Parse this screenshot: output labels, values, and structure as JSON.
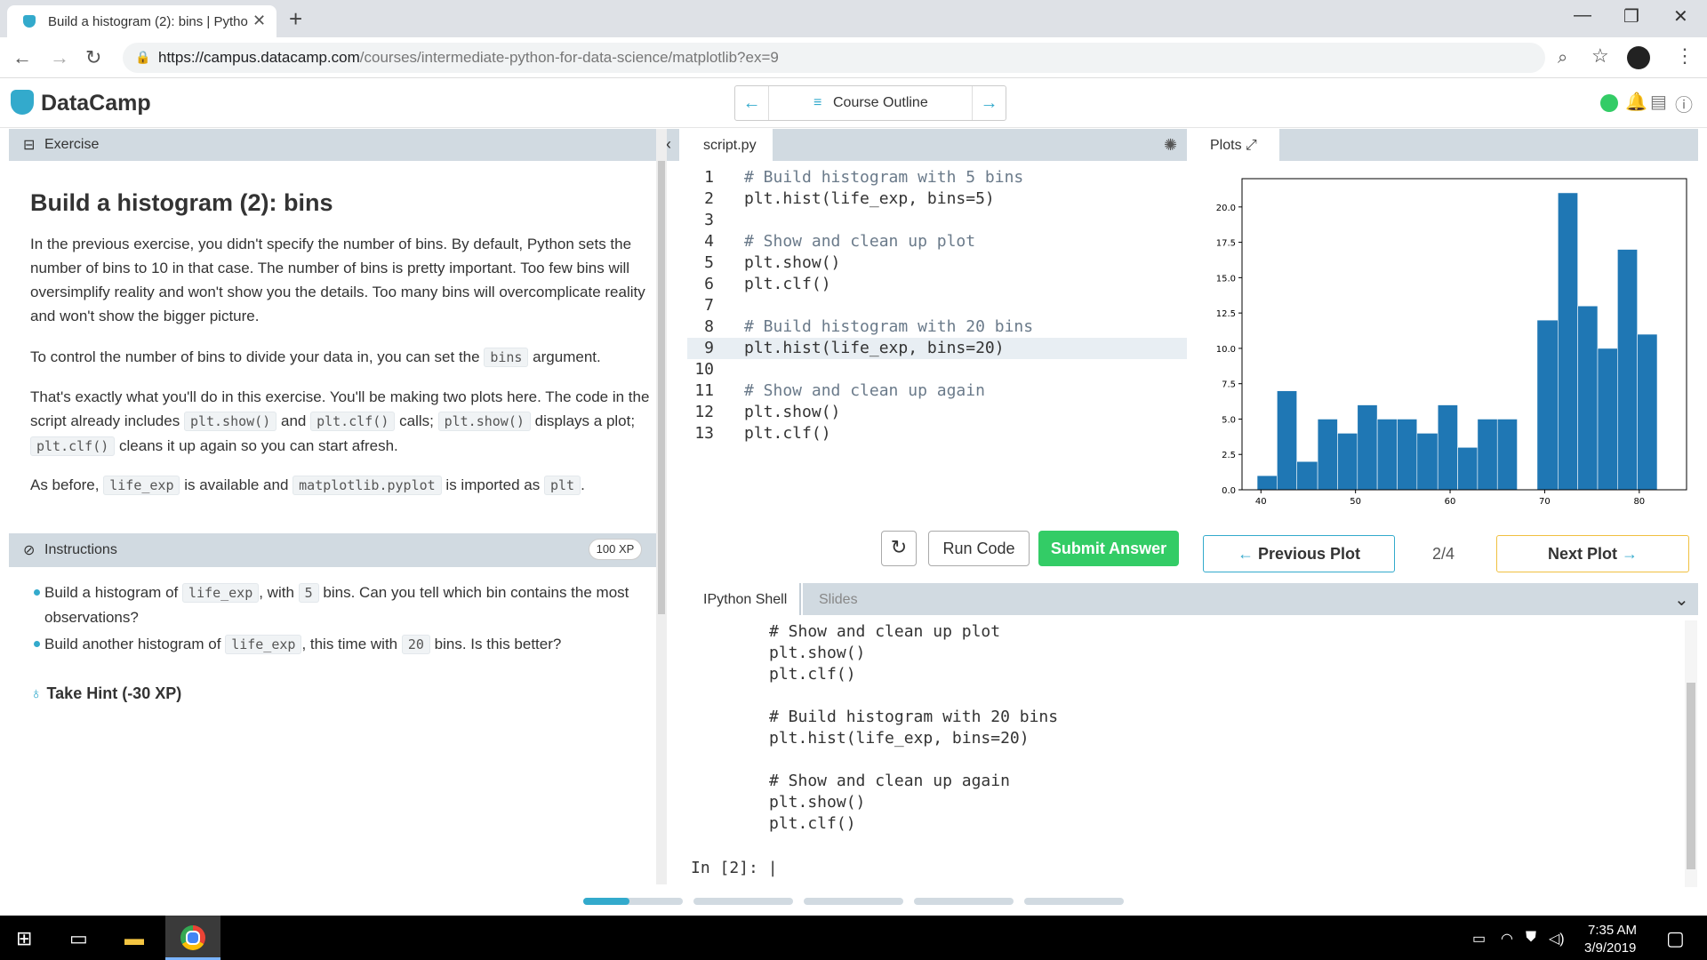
{
  "browser": {
    "tab_title": "Build a histogram (2): bins | Pytho",
    "url_host": "https://campus.datacamp.com",
    "url_path": "/courses/intermediate-python-for-data-science/matplotlib?ex=9"
  },
  "header": {
    "logo": "DataCamp",
    "course_outline": "Course Outline"
  },
  "exercise": {
    "panel_label": "Exercise",
    "title": "Build a histogram (2): bins",
    "p1": "In the previous exercise, you didn't specify the number of bins. By default, Python sets the number of bins to 10 in that case. The number of bins is pretty important. Too few bins will oversimplify reality and won't show you the details. Too many bins will overcomplicate reality and won't show the bigger picture.",
    "p2_a": "To control the number of bins to divide your data in, you can set the",
    "p2_code": "bins",
    "p2_b": "argument.",
    "p3_a": "That's exactly what you'll do in this exercise. You'll be making two plots here. The code in the script already includes",
    "p3_code1": "plt.show()",
    "p3_and": "and",
    "p3_code2": "plt.clf()",
    "p3_calls": "calls;",
    "p3_code3": "plt.show()",
    "p3_displays": "displays a plot;",
    "p3_code4": "plt.clf()",
    "p3_end": "cleans it up again so you can start afresh.",
    "p4_a": "As before,",
    "p4_code1": "life_exp",
    "p4_b": "is available and",
    "p4_code2": "matplotlib.pyplot",
    "p4_c": "is imported as",
    "p4_code3": "plt",
    "p4_d": "."
  },
  "instructions": {
    "label": "Instructions",
    "xp": "100 XP",
    "b1_a": "Build a histogram of",
    "b1_code1": "life_exp",
    "b1_b": ", with",
    "b1_code2": "5",
    "b1_c": "bins. Can you tell which bin contains the most observations?",
    "b2_a": "Build another histogram of",
    "b2_code1": "life_exp",
    "b2_b": ", this time with",
    "b2_code2": "20",
    "b2_c": "bins. Is this better?",
    "hint": "Take Hint (-30 XP)"
  },
  "editor": {
    "tab": "script.py",
    "lines": [
      "# Build histogram with 5 bins",
      "plt.hist(life_exp, bins=5)",
      "",
      "# Show and clean up plot",
      "plt.show()",
      "plt.clf()",
      "",
      "# Build histogram with 20 bins",
      "plt.hist(life_exp, bins=20)",
      "",
      "# Show and clean up again",
      "plt.show()",
      "plt.clf()"
    ],
    "line_numbers": [
      "1",
      "2",
      "3",
      "4",
      "5",
      "6",
      "7",
      "8",
      "9",
      "10",
      "11",
      "12",
      "13"
    ],
    "run_label": "Run Code",
    "submit_label": "Submit Answer"
  },
  "plots": {
    "tab": "Plots",
    "prev": "Previous Plot",
    "page": "2/4",
    "next": "Next Plot"
  },
  "chart_data": {
    "type": "bar",
    "bin_edges": [
      39.6,
      41.7,
      43.8,
      46.0,
      48.1,
      50.2,
      52.3,
      54.4,
      56.5,
      58.7,
      60.8,
      62.9,
      65.0,
      67.1,
      69.2,
      71.4,
      73.5,
      75.6,
      77.7,
      79.8,
      81.9
    ],
    "values": [
      1,
      7,
      2,
      5,
      4,
      6,
      5,
      5,
      4,
      6,
      3,
      5,
      5,
      0,
      12,
      21,
      13,
      10,
      17,
      11
    ],
    "xlim": [
      38,
      85
    ],
    "ylim": [
      0,
      22
    ],
    "xticks": [
      "40",
      "50",
      "60",
      "70",
      "80"
    ],
    "xtick_values": [
      40,
      50,
      60,
      70,
      80
    ],
    "yticks": [
      "0.0",
      "2.5",
      "5.0",
      "7.5",
      "10.0",
      "12.5",
      "15.0",
      "17.5",
      "20.0"
    ],
    "ytick_values": [
      0,
      2.5,
      5,
      7.5,
      10,
      12.5,
      15,
      17.5,
      20
    ],
    "color": "#1f77b4"
  },
  "shell": {
    "tab1": "IPython Shell",
    "tab2": "Slides",
    "lines": [
      "# Show and clean up plot",
      "plt.show()",
      "plt.clf()",
      "",
      "# Build histogram with 20 bins",
      "plt.hist(life_exp, bins=20)",
      "",
      "# Show and clean up again",
      "plt.show()",
      "plt.clf()"
    ],
    "prompt": "In [2]:"
  },
  "taskbar": {
    "time": "7:35 AM",
    "date": "3/9/2019"
  },
  "colors": {
    "accent": "#33aacc",
    "submit": "#33cc66",
    "panel_header": "#d1dae1"
  }
}
